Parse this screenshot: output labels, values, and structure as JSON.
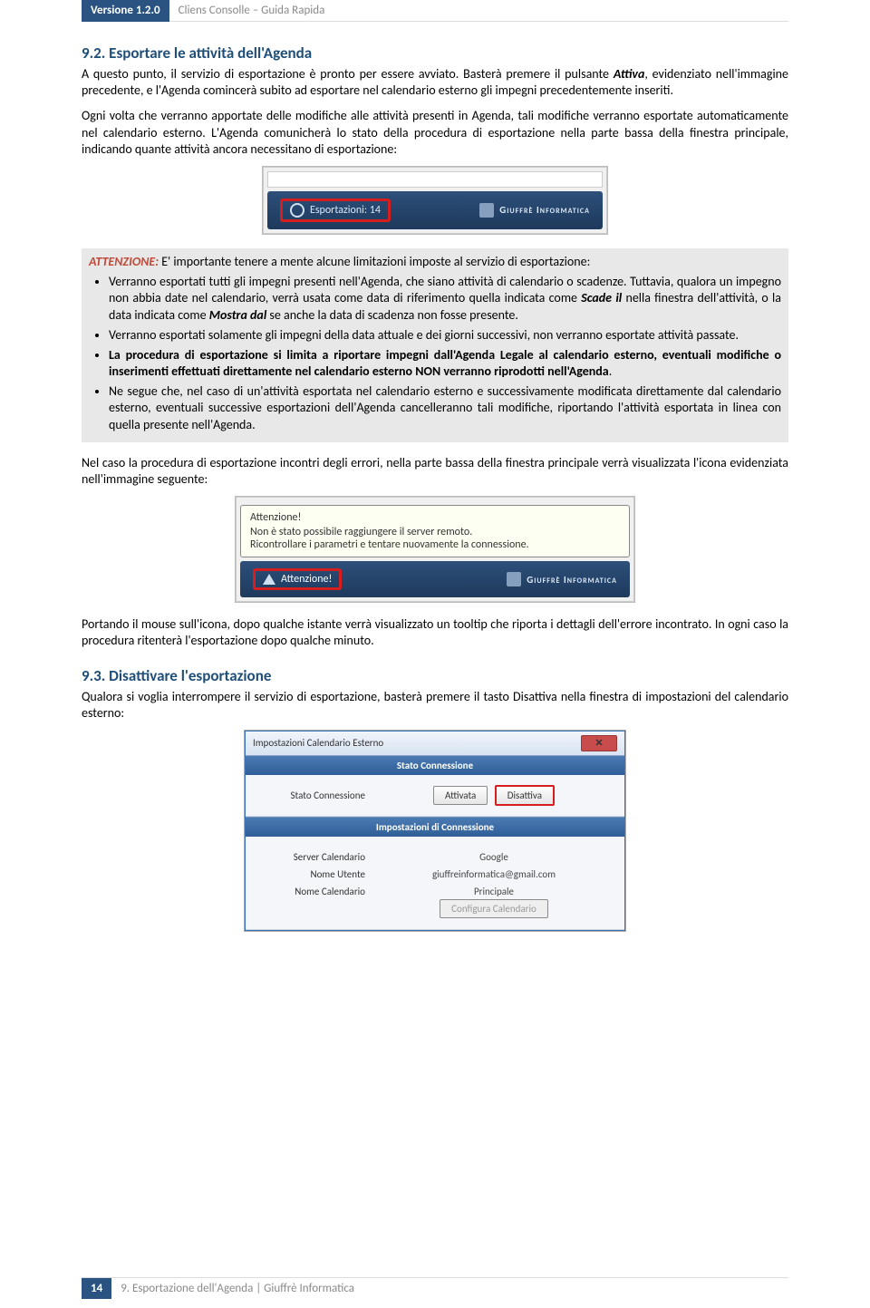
{
  "header": {
    "version": "Versione 1.2.0",
    "title": "Cliens Consolle – Guida Rapida"
  },
  "section92": {
    "heading": "9.2. Esportare le attività dell'Agenda",
    "p1_a": "A questo punto, il servizio di esportazione è pronto per essere avviato. Basterà premere il pulsante ",
    "p1_attiva": "Attiva",
    "p1_b": ", evidenziato nell'immagine precedente, e l'Agenda comincerà subito ad esportare nel calendario esterno gli impegni precedentemente inseriti.",
    "p2": "Ogni volta che verranno apportate delle modifiche alle attività presenti in Agenda, tali modifiche verranno esportate automaticamente nel calendario esterno. L'Agenda comunicherà lo stato della procedura di esportazione nella parte bassa della finestra principale, indicando quante attività ancora necessitano di esportazione:"
  },
  "fig1": {
    "badge": "Esportazioni: 14",
    "brand": "Giuffrè Informatica"
  },
  "attention": {
    "label": "ATTENZIONE:",
    "intro": " E' importante tenere a mente alcune limitazioni imposte al servizio di esportazione:",
    "b1_a": "Verranno esportati tutti gli impegni presenti nell'Agenda, che siano attività di calendario o scadenze. Tuttavia, qualora un impegno non abbia date nel calendario, verrà usata come data di riferimento quella indicata come ",
    "b1_scade": "Scade il",
    "b1_b": " nella finestra dell'attività, o la data indicata come ",
    "b1_mostra": "Mostra dal",
    "b1_c": " se anche la data di scadenza non fosse presente.",
    "b2": "Verranno esportati solamente gli impegni della data attuale e dei giorni successivi, non verranno esportate attività passate.",
    "b3": "La procedura di esportazione si limita a riportare impegni dall'Agenda Legale al calendario esterno, eventuali modifiche o inserimenti effettuati direttamente nel calendario esterno NON verranno riprodotti nell'Agenda",
    "b3_end": ".",
    "b4": "Ne segue che, nel caso di un'attività esportata nel calendario esterno e successivamente modificata direttamente dal calendario esterno, eventuali successive esportazioni dell'Agenda cancelleranno tali modifiche, riportando l'attività esportata in linea con quella presente nell'Agenda."
  },
  "p_err": "Nel caso la procedura di esportazione incontri degli errori, nella parte bassa della finestra principale verrà visualizzata l'icona evidenziata nell'immagine seguente:",
  "fig2": {
    "tt_title": "Attenzione!",
    "tt_line1": "Non è stato possibile raggiungere il server remoto.",
    "tt_line2": "Ricontrollare i parametri e tentare nuovamente la connessione.",
    "badge": "Attenzione!",
    "brand": "Giuffrè Informatica"
  },
  "p_tooltip": "Portando il mouse sull'icona, dopo qualche istante verrà visualizzato un tooltip che riporta i dettagli dell'errore incontrato. In ogni caso la procedura ritenterà l'esportazione dopo qualche minuto.",
  "section93": {
    "heading": "9.3. Disattivare l'esportazione",
    "p1": "Qualora si voglia interrompere il servizio di esportazione, basterà premere il tasto Disattiva nella finestra di impostazioni del calendario esterno:"
  },
  "fig3": {
    "title": "Impostazioni Calendario Esterno",
    "sec1": "Stato Connessione",
    "row1_label": "Stato Connessione",
    "row1_btn1": "Attivata",
    "row1_btn2": "Disattiva",
    "sec2": "Impostazioni di Connessione",
    "row2_label": "Server Calendario",
    "row2_val": "Google",
    "row3_label": "Nome Utente",
    "row3_val": "giuffreinformatica@gmail.com",
    "row4_label": "Nome Calendario",
    "row4_val": "Principale",
    "row5_btn": "Configura Calendario"
  },
  "footer": {
    "page": "14",
    "text": "9. Esportazione dell'Agenda | Giuffrè Informatica"
  }
}
